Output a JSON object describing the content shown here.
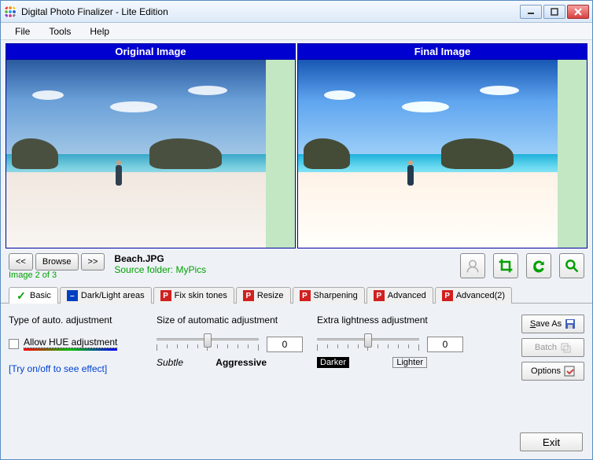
{
  "window": {
    "title": "Digital Photo Finalizer - Lite Edition"
  },
  "menu": {
    "file": "File",
    "tools": "Tools",
    "help": "Help"
  },
  "preview": {
    "original": "Original Image",
    "final": "Final Image"
  },
  "nav": {
    "prev": "<<",
    "browse": "Browse",
    "next": ">>",
    "filename": "Beach.JPG",
    "source": "Source folder: MyPics",
    "count": "Image 2 of 3"
  },
  "toolbar_icons": {
    "face": "face-icon",
    "crop": "crop-icon",
    "refresh": "refresh-icon",
    "zoom": "zoom-icon"
  },
  "tabs": {
    "basic": "Basic",
    "dark": "Dark/Light areas",
    "skin": "Fix skin tones",
    "resize": "Resize",
    "sharpen": "Sharpening",
    "advanced": "Advanced",
    "advanced2": "Advanced(2)"
  },
  "panel": {
    "type_title": "Type of auto. adjustment",
    "hue_label": "Allow HUE adjustment",
    "try_link": "[Try on/off to see effect]",
    "size_title": "Size of automatic adjustment",
    "size_value": "0",
    "size_min": "Subtle",
    "size_max": "Aggressive",
    "extra_title": "Extra lightness adjustment",
    "extra_value": "0",
    "extra_min": "Darker",
    "extra_max": "Lighter"
  },
  "side": {
    "saveas": "Save As",
    "batch": "Batch",
    "options": "Options"
  },
  "footer": {
    "exit": "Exit"
  }
}
